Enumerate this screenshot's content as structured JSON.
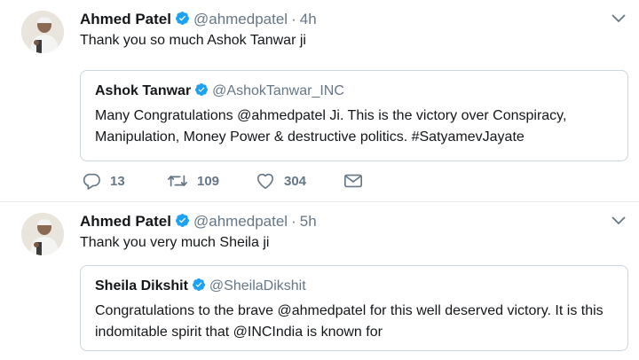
{
  "tweets": [
    {
      "author_name": "Ahmed Patel",
      "author_handle": "@ahmedpatel",
      "separator": "·",
      "time": "4h",
      "text": "Thank you so much Ashok Tanwar ji",
      "quote": {
        "author_name": "Ashok Tanwar",
        "author_handle": "@AshokTanwar_INC",
        "text": "Many Congratulations @ahmedpatel Ji. This is the victory over Conspiracy, Manipulation, Money Power & destructive politics. #SatyamevJayate"
      },
      "actions": {
        "reply_count": "13",
        "retweet_count": "109",
        "like_count": "304"
      }
    },
    {
      "author_name": "Ahmed Patel",
      "author_handle": "@ahmedpatel",
      "separator": "·",
      "time": "5h",
      "text": "Thank you very much Sheila ji",
      "quote": {
        "author_name": "Sheila Dikshit",
        "author_handle": "@SheilaDikshit",
        "text": "Congratulations to the brave @ahmedpatel for this well deserved victory. It is this indomitable spirit that @INCIndia is known for"
      }
    }
  ],
  "colors": {
    "verified_blue": "#1da1f2",
    "secondary_text": "#657786",
    "border": "#ccd6dd"
  },
  "icons": [
    "avatar-photo",
    "verified-icon",
    "caret-down-icon",
    "reply-icon",
    "retweet-icon",
    "like-icon",
    "direct-message-icon"
  ]
}
